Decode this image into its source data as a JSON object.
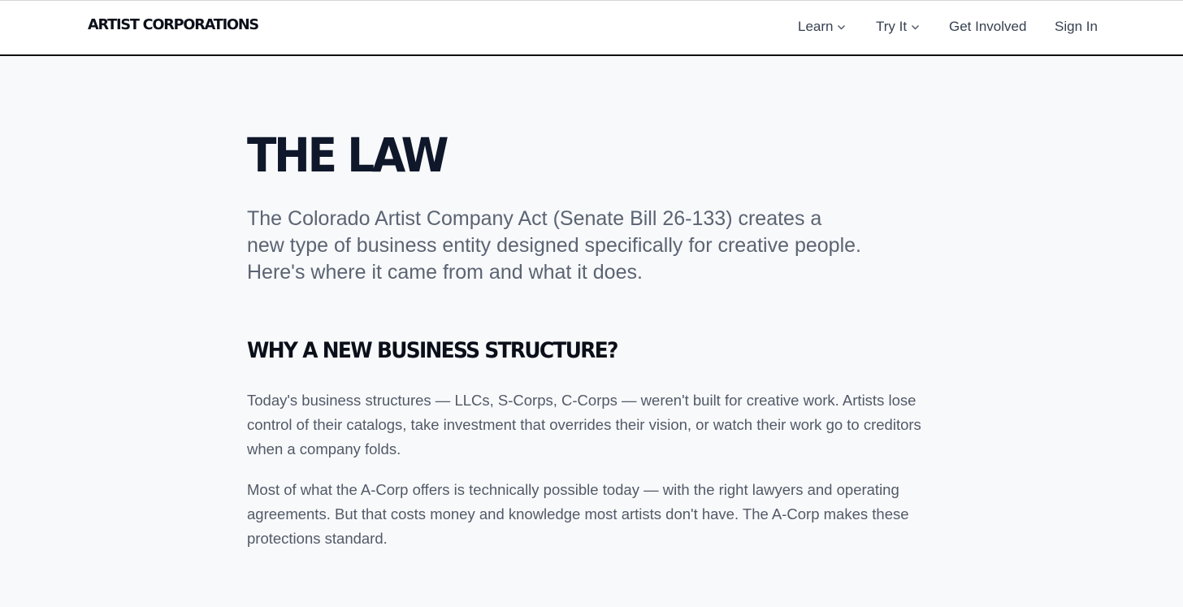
{
  "header": {
    "brand": "ARTIST CORPORATIONS",
    "nav": [
      {
        "label": "Learn",
        "has_dropdown": true
      },
      {
        "label": "Try It",
        "has_dropdown": true
      },
      {
        "label": "Get Involved",
        "has_dropdown": false
      },
      {
        "label": "Sign In",
        "has_dropdown": false
      }
    ]
  },
  "main": {
    "title": "THE LAW",
    "lead": "The Colorado Artist Company Act (Senate Bill 26-133) creates a new type of business entity designed specifically for creative people. Here's where it came from and what it does.",
    "section": {
      "heading": "WHY A NEW BUSINESS STRUCTURE?",
      "paragraphs": [
        "Today's business structures — LLCs, S-Corps, C-Corps — weren't built for creative work. Artists lose control of their catalogs, take investment that overrides their vision, or watch their work go to creditors when a company folds.",
        "Most of what the A-Corp offers is technically possible today — with the right lawyers and operating agreements. But that costs money and knowledge most artists don't have. The A-Corp makes these protections standard."
      ]
    }
  },
  "colors": {
    "background": "#f8f9fb",
    "header_bg": "#ffffff",
    "heading": "#0b0f19",
    "body_text": "#525a67"
  }
}
